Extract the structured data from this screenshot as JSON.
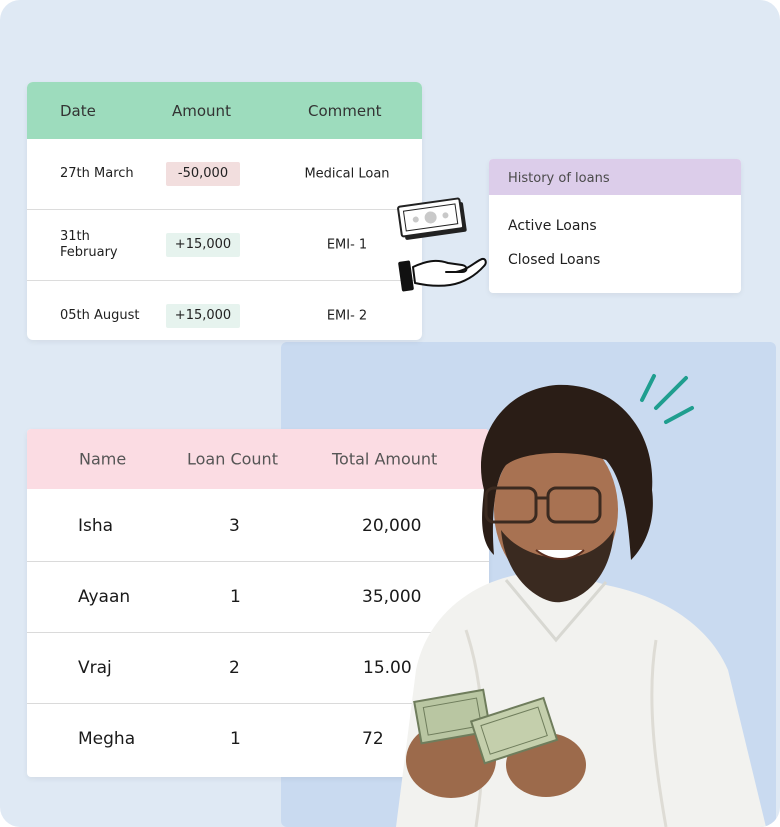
{
  "transactions": {
    "headers": {
      "date": "Date",
      "amount": "Amount",
      "comment": "Comment"
    },
    "rows": [
      {
        "date": "27th March",
        "amount": "-50,000",
        "comment": "Medical Loan",
        "type": "debit"
      },
      {
        "date": "31th February",
        "amount": "+15,000",
        "comment": "EMI- 1",
        "type": "credit"
      },
      {
        "date": "05th August",
        "amount": "+15,000",
        "comment": "EMI- 2",
        "type": "credit"
      }
    ]
  },
  "history": {
    "title": "History of loans",
    "items": [
      "Active Loans",
      "Closed Loans"
    ]
  },
  "loans_table": {
    "headers": {
      "name": "Name",
      "count": "Loan Count",
      "total": "Total Amount"
    },
    "rows": [
      {
        "name": "Isha",
        "count": "3",
        "total": "20,000"
      },
      {
        "name": "Ayaan",
        "count": "1",
        "total": "35,000"
      },
      {
        "name": "Vraj",
        "count": "2",
        "total": "15.00"
      },
      {
        "name": "Megha",
        "count": "1",
        "total": "72"
      }
    ]
  },
  "icons": [
    "cash-note-icon",
    "open-hand-icon",
    "sparkle-lines-icon"
  ],
  "colors": {
    "background": "#dfe9f4",
    "panel_blue": "#c9daf0",
    "tx_header": "#9ddcbd",
    "history_header": "#dccdea",
    "loans_header": "#fbdce3",
    "debit_badge": "#f2dede",
    "credit_badge": "#e6f3ee",
    "sparkle": "#1f9e8f"
  }
}
